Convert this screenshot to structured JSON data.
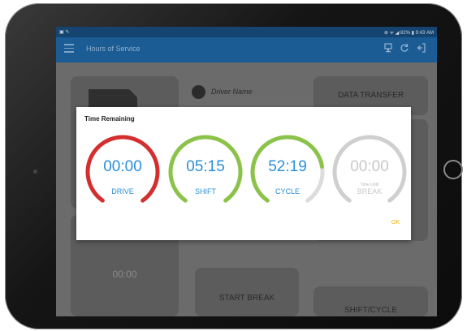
{
  "status_bar": {
    "left_icons": "▣ ✎",
    "right_text": "⊕ ᯤ ◢ 82% ▮ 9:43 AM"
  },
  "app_bar": {
    "title": "Hours of Service",
    "icons": [
      "menu-icon",
      "device-icon",
      "refresh-icon",
      "logout-icon"
    ]
  },
  "background": {
    "driver_name": "Driver Name",
    "data_transfer": "DATA TRANSFER",
    "time_value": "00:00",
    "start_break": "START BREAK",
    "shift_cycle": "SHIFT/CYCLE"
  },
  "dialog": {
    "title": "Time Remaining",
    "ok_label": "OK",
    "gauges": [
      {
        "time": "00:00",
        "label": "DRIVE",
        "color": "#d32f2f",
        "fill": 1.0
      },
      {
        "time": "05:15",
        "label": "SHIFT",
        "color": "#8bc34a",
        "fill": 1.0
      },
      {
        "time": "52:19",
        "label": "CYCLE",
        "color": "#8bc34a",
        "fill": 0.78
      },
      {
        "time": "00:00",
        "label": "BREAK",
        "sublabel": "Time Until",
        "color": "#cfcfcf",
        "fill": 1.0
      }
    ]
  },
  "colors": {
    "status_bar": "#14446f",
    "app_bar": "#1c5c94",
    "accent_text": "#2a8fd8",
    "ok": "#f0b300"
  }
}
